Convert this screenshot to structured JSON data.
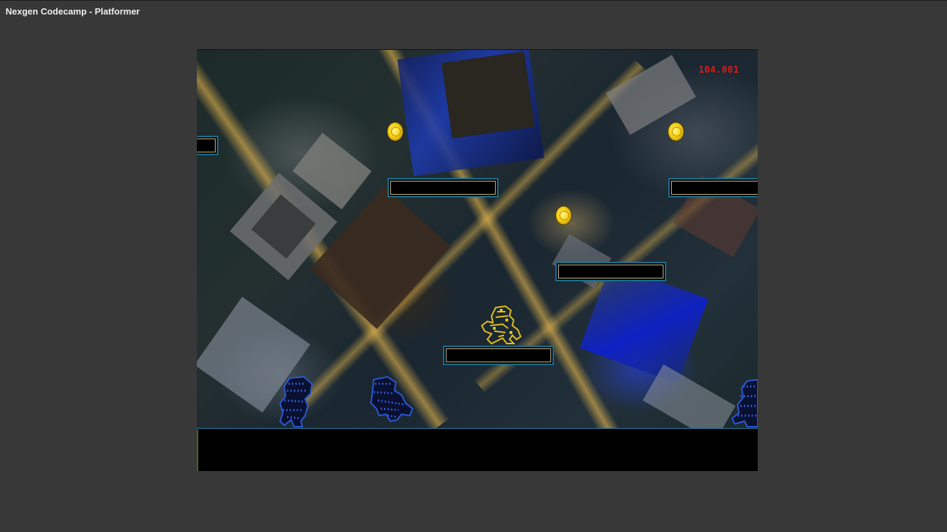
{
  "window": {
    "title": "Nexgen Codecamp - Platformer"
  },
  "hud": {
    "score_text": "104.001"
  },
  "game": {
    "coins": [
      "coin",
      "coin",
      "coin"
    ],
    "platforms": [
      "platform",
      "platform",
      "platform",
      "platform",
      "platform"
    ],
    "player": {
      "sprite": "yellow-pixel-ninja",
      "color": "#e8c21a"
    },
    "enemies": [
      {
        "sprite": "blue-pixel-ninja",
        "color": "#2a5ad8"
      },
      {
        "sprite": "blue-pixel-ninja",
        "color": "#2a5ad8"
      },
      {
        "sprite": "blue-pixel-ninja",
        "color": "#2a5ad8"
      }
    ],
    "colors": {
      "platform_border": "#1b6f8f",
      "score": "#e01a1a",
      "background": "#383838"
    }
  }
}
